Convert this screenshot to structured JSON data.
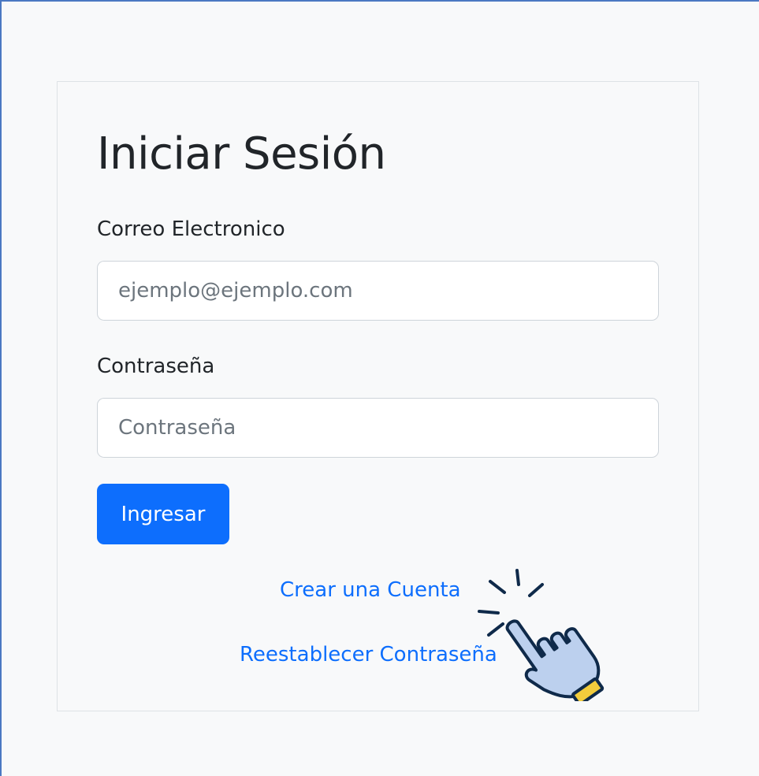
{
  "form": {
    "title": "Iniciar Sesión",
    "email_label": "Correo Electronico",
    "email_placeholder": "ejemplo@ejemplo.com",
    "email_value": "",
    "password_label": "Contraseña",
    "password_placeholder": "Contraseña",
    "password_value": "",
    "submit_label": "Ingresar"
  },
  "links": {
    "create_account": "Crear una Cuenta",
    "reset_password": "Reestablecer Contraseña"
  },
  "icons": {
    "cursor": "pointing-hand-click-icon"
  },
  "colors": {
    "primary": "#0d6efd",
    "background": "#f8f9fa",
    "text": "#212529",
    "placeholder": "#6c757d",
    "hand_fill": "#bcd0ee",
    "hand_outline": "#0f2a4a",
    "cuff": "#f2cc3c"
  }
}
